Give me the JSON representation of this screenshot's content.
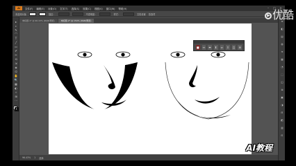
{
  "menubar": {
    "app_logo": "Ai",
    "items": [
      "文件(F)",
      "编辑(E)",
      "对象(O)",
      "文字(T)",
      "选择(S)",
      "效果(C)",
      "视图(V)",
      "窗口(W)",
      "帮助(H)"
    ],
    "window_controls": [
      "–",
      "□",
      "×"
    ]
  },
  "controlbar": {
    "label": "未选择对象",
    "stroke_label": "描边：",
    "opacity_label": "不透明度：",
    "style_label": "样式：",
    "doc_setup": "文档设置",
    "prefs": "首选项"
  },
  "tabs": [
    {
      "label": "未标题-1* @ 96.43% (RGB/预览)"
    },
    {
      "label": "未标题-2* @ 150% (RGB/预览)"
    }
  ],
  "toolbar": {
    "tools": [
      "▸",
      "▹",
      "✎",
      "⌒",
      "T",
      "╱",
      "▭",
      "✐",
      "✂",
      "⟲",
      "⇲",
      "◈",
      "⌬",
      "✋",
      "🔍",
      "▦",
      "◐",
      "✧",
      "⊞",
      "⋯"
    ]
  },
  "right_dock": {
    "icons": [
      "≡",
      "◧",
      "▤",
      "◍",
      "≋",
      "▦",
      "◔",
      "⬚",
      "◫",
      "⧉",
      "▣",
      "◑",
      "⊟",
      "◩",
      "▥",
      "⊡"
    ]
  },
  "float_panel": {
    "icons": [
      "■",
      "↔",
      "⬌",
      "⬍",
      "⇔",
      "⇕",
      "◫",
      "⊞"
    ]
  },
  "statusbar": {
    "zoom": "96.43%",
    "page": "1",
    "tool_name": "选择"
  },
  "watermark": {
    "brand": "优酷",
    "title": "AI教程"
  }
}
